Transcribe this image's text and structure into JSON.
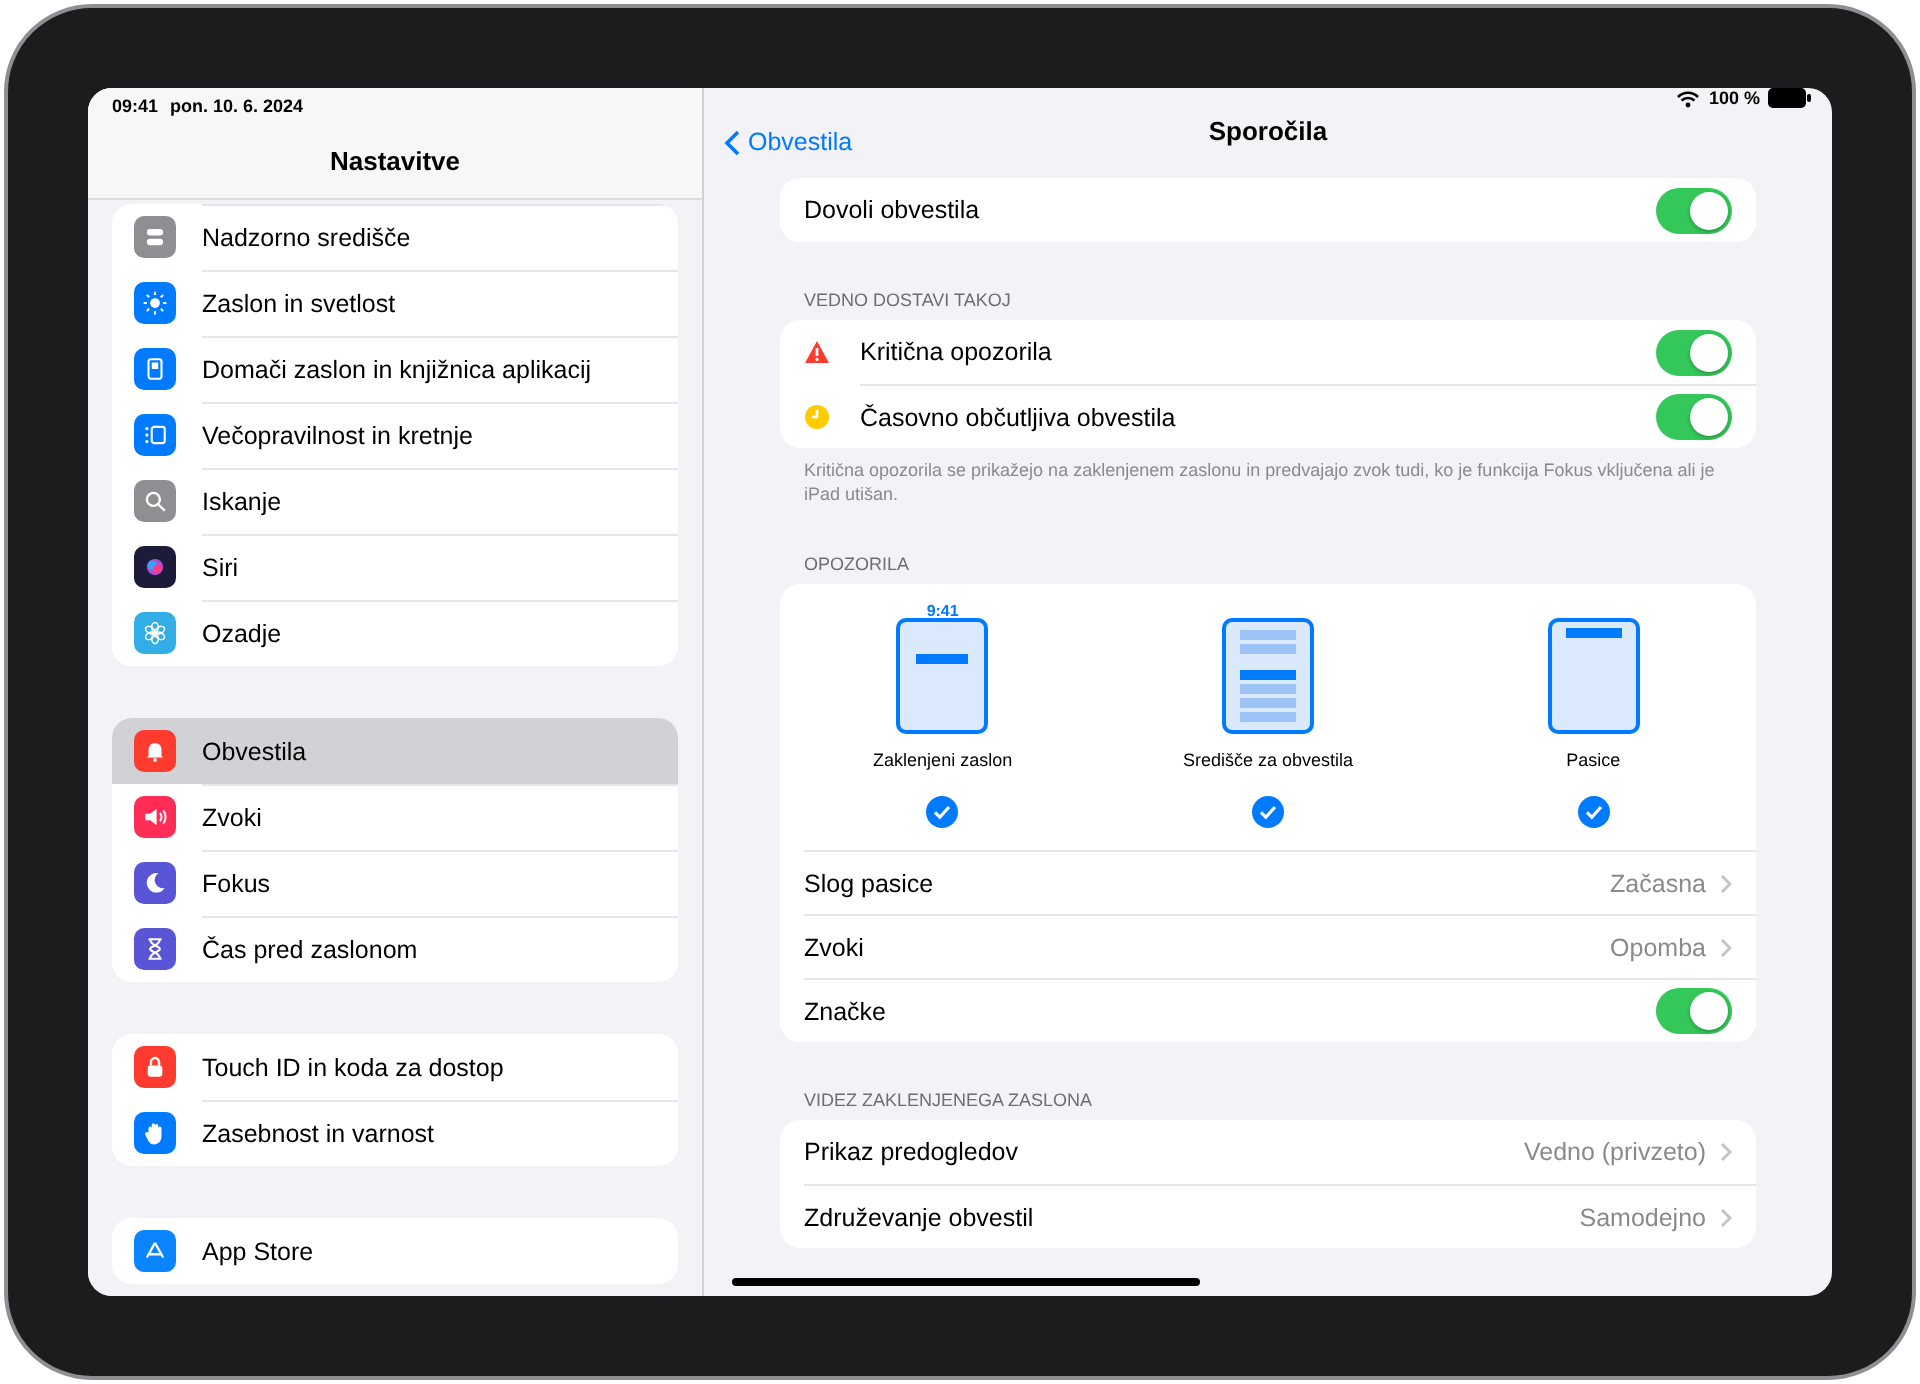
{
  "status_bar": {
    "time": "09:41",
    "date": "pon. 10. 6. 2024",
    "battery": "100 %"
  },
  "sidebar": {
    "title": "Nastavitve",
    "groups": [
      {
        "items": [
          {
            "label": "Nadzorno središče",
            "selected": false
          },
          {
            "label": "Zaslon in svetlost",
            "selected": false
          },
          {
            "label": "Domači zaslon in knjižnica aplikacij",
            "selected": false
          },
          {
            "label": "Večopravilnost in kretnje",
            "selected": false
          },
          {
            "label": "Iskanje",
            "selected": false
          },
          {
            "label": "Siri",
            "selected": false
          },
          {
            "label": "Ozadje",
            "selected": false
          }
        ]
      },
      {
        "items": [
          {
            "label": "Obvestila",
            "selected": true
          },
          {
            "label": "Zvoki",
            "selected": false
          },
          {
            "label": "Fokus",
            "selected": false
          },
          {
            "label": "Čas pred zaslonom",
            "selected": false
          }
        ]
      },
      {
        "items": [
          {
            "label": "Touch ID in koda za dostop",
            "selected": false
          },
          {
            "label": "Zasebnost in varnost",
            "selected": false
          }
        ]
      },
      {
        "items": [
          {
            "label": "App Store",
            "selected": false
          }
        ]
      }
    ]
  },
  "detail": {
    "back": "Obvestila",
    "title": "Sporočila",
    "sections": [
      {
        "rows": [
          {
            "kind": "toggle",
            "label": "Dovoli obvestila",
            "on": true
          }
        ]
      },
      {
        "header": "VEDNO DOSTAVI TAKOJ",
        "rows": [
          {
            "kind": "toggle",
            "label": "Kritična opozorila",
            "on": true
          },
          {
            "kind": "toggle",
            "label": "Časovno občutljiva obvestila",
            "on": true
          }
        ],
        "footer": "Kritična opozorila se prikažejo na zaklenjenem zaslonu in predvajajo zvok tudi, ko je funkcija Fokus vključena ali je iPad utišan."
      },
      {
        "header": "OPOZORILA",
        "alerts": [
          {
            "kind": "lockscreen",
            "label": "Zaklenjeni zaslon",
            "time": "9:41",
            "checked": true
          },
          {
            "kind": "center",
            "label": "Središče za obvestila",
            "checked": true
          },
          {
            "kind": "banner",
            "label": "Pasice",
            "checked": true
          }
        ],
        "rows": [
          {
            "kind": "link",
            "label": "Slog pasice",
            "value": "Začasna"
          },
          {
            "kind": "link",
            "label": "Zvoki",
            "value": "Opomba"
          },
          {
            "kind": "toggle",
            "label": "Značke",
            "on": true
          }
        ]
      },
      {
        "header": "VIDEZ ZAKLENJENEGA ZASLONA",
        "rows": [
          {
            "kind": "link",
            "label": "Prikaz predogledov",
            "value": "Vedno (privzeto)"
          },
          {
            "kind": "link",
            "label": "Združevanje obvestil",
            "value": "Samodejno"
          }
        ]
      }
    ]
  }
}
